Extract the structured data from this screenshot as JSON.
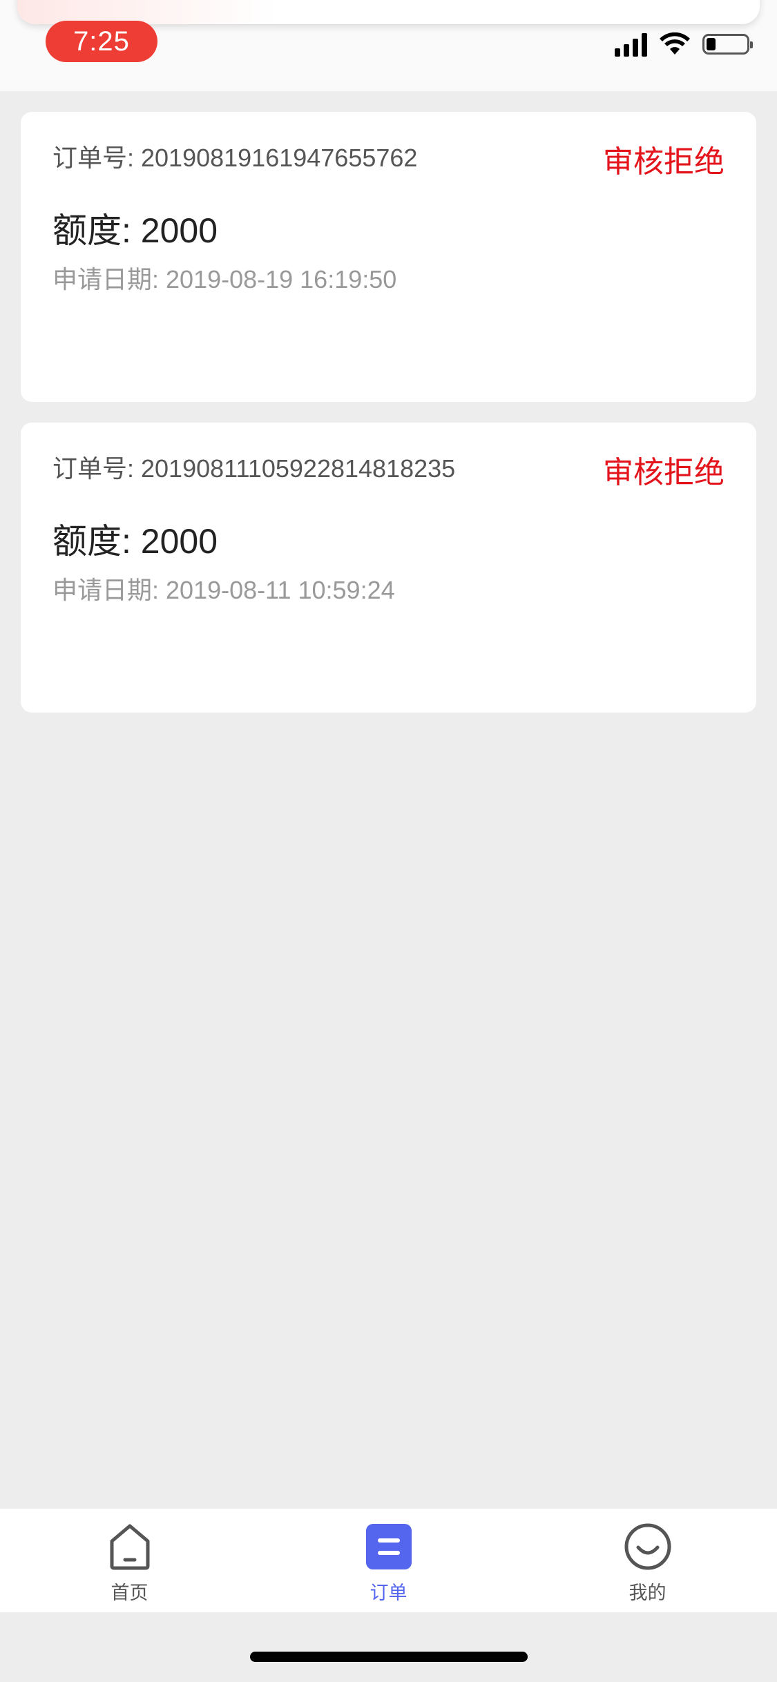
{
  "status_bar": {
    "time": "7:25",
    "signal_icon": "cellular-signal-icon",
    "wifi_icon": "wifi-icon",
    "battery_icon": "battery-low-icon",
    "time_pill_color": "#ee3d34"
  },
  "orders": [
    {
      "order_no": "订单号: 20190819161947655762",
      "status": "审核拒绝",
      "amount": "额度: 2000",
      "date": "申请日期: 2019-08-19 16:19:50"
    },
    {
      "order_no": "订单号: 20190811105922814818235",
      "status": "审核拒绝",
      "amount": "额度: 2000",
      "date": "申请日期: 2019-08-11 10:59:24"
    }
  ],
  "tab_bar": {
    "tabs": [
      {
        "label": "首页",
        "icon": "home-icon",
        "active": false
      },
      {
        "label": "订单",
        "icon": "orders-icon",
        "active": true
      },
      {
        "label": "我的",
        "icon": "smile-face-icon",
        "active": false
      }
    ]
  },
  "colors": {
    "status_rejected": "#e4141c",
    "accent": "#5465ee",
    "background": "#ededed"
  }
}
